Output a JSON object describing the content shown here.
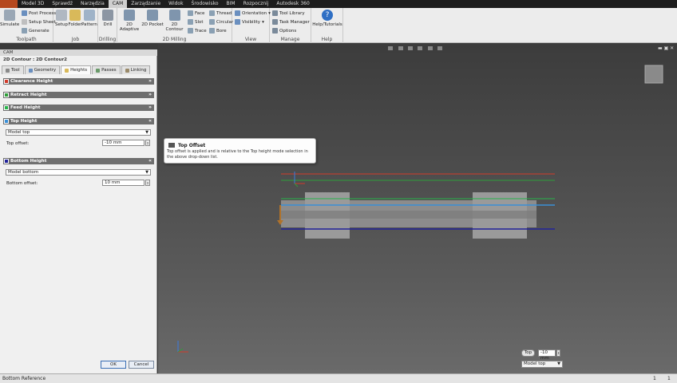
{
  "menu": [
    "Model 3D",
    "Sprawdź",
    "Narzędzia",
    "CAM",
    "Zarządzanie",
    "Widok",
    "Środowisko",
    "BIM",
    "Rozpocznij",
    "Autodesk 360"
  ],
  "menu_active": "CAM",
  "ribbon": {
    "toolpath": {
      "label": "Toolpath",
      "simulate": "Simulate",
      "post_process": "Post Process",
      "setup_sheet": "Setup Sheet",
      "generate": "Generate"
    },
    "job": {
      "label": "Job",
      "setup": "Setup",
      "folder": "Folder",
      "pattern": "Pattern"
    },
    "drilling": {
      "label": "Drilling",
      "drill": "Drill"
    },
    "milling": {
      "label": "2D Milling",
      "adaptive": "2D Adaptive",
      "pocket": "2D Pocket",
      "contour": "2D Contour",
      "face": "Face",
      "slot": "Slot",
      "trace": "Trace",
      "thread": "Thread",
      "circular": "Circular",
      "bore": "Bore"
    },
    "view": {
      "label": "View",
      "orientation": "Orientation",
      "visibility": "Visibility"
    },
    "manage": {
      "label": "Manage",
      "tool_library": "Tool Library",
      "task_manager": "Task Manager",
      "options": "Options"
    },
    "help": {
      "label": "Help",
      "help_tutorials": "Help/Tutorials"
    }
  },
  "panel": {
    "title": "CAM",
    "operation": "2D Contour : 2D Contour2",
    "tabs": [
      "Tool",
      "Geometry",
      "Heights",
      "Passes",
      "Linking"
    ],
    "active_tab": "Heights",
    "sections": {
      "clearance": "Clearance Height",
      "retract": "Retract Height",
      "feed": "Feed Height",
      "top": "Top Height",
      "bottom": "Bottom Height"
    },
    "top_mode": "Model top",
    "top_offset_label": "Top offset:",
    "top_offset_value": "-10 mm",
    "bottom_mode": "Model bottom",
    "bottom_offset_label": "Bottom offset:",
    "bottom_offset_value": "10 mm",
    "ok": "OK",
    "cancel": "Cancel"
  },
  "tooltip": {
    "title": "Top Offset",
    "body": "Top offset is applied and is relative to the Top height mode selection in the above drop-down list."
  },
  "viewport_widget": {
    "label": "Top",
    "value": "-10 mm",
    "mode": "Model top"
  },
  "status": {
    "left": "Bottom Reference",
    "right1": "1",
    "right2": "1"
  },
  "colors": {
    "clearance": "#d13b2a",
    "retract": "#2f9e3a",
    "feed": "#27b34a",
    "top": "#3a8fd6",
    "bottom": "#22239a"
  }
}
